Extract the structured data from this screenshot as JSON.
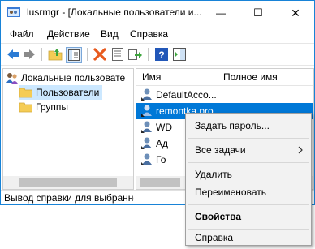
{
  "window": {
    "title": "lusrmgr - [Локальные пользователи и...",
    "controls": {
      "minimize": "—",
      "maximize": "☐",
      "close": "✕"
    }
  },
  "menu": [
    "Файл",
    "Действие",
    "Вид",
    "Справка"
  ],
  "toolbar": {
    "icons": [
      "back-arrow-icon",
      "forward-arrow-icon",
      "up-folder-icon",
      "show-tree-icon",
      "delete-icon",
      "properties-icon",
      "export-icon",
      "help-icon",
      "action-pane-icon"
    ]
  },
  "tree": {
    "root": "Локальные пользовате",
    "items": [
      "Пользователи",
      "Группы"
    ],
    "selected": "Пользователи"
  },
  "list": {
    "columns": [
      "Имя",
      "Полное имя"
    ],
    "rows": [
      {
        "name": "DefaultAcco..."
      },
      {
        "name": "remontka.pro",
        "selected": true
      },
      {
        "name": "WD"
      },
      {
        "name": "Ад"
      },
      {
        "name": "Го"
      }
    ]
  },
  "status": "Вывод справки для выбранно",
  "context_menu": {
    "items": [
      {
        "label": "Задать пароль..."
      },
      {
        "label": "Все задачи",
        "submenu": true
      },
      {
        "label": "Удалить"
      },
      {
        "label": "Переименовать"
      },
      {
        "label": "Свойства",
        "bold": true
      },
      {
        "label": "Справка"
      }
    ]
  },
  "colors": {
    "selection": "#0078d7",
    "tree_selection": "#cce8ff",
    "folder": "#f5cc55",
    "delete": "#e85a1e"
  }
}
